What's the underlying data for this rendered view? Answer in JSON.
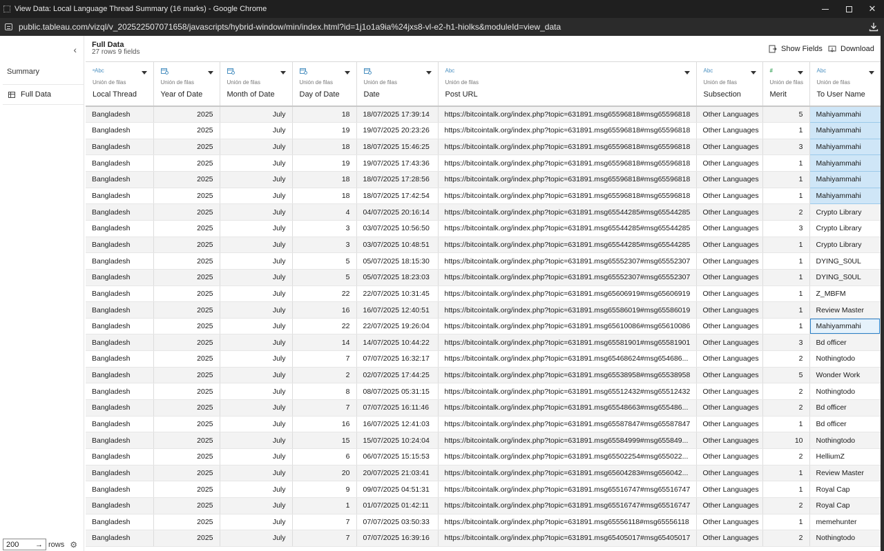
{
  "window": {
    "title": "View Data: Local Language Thread Summary (16 marks) - Google Chrome",
    "url": "public.tableau.com/vizql/v_202522507071658/javascripts/hybrid-window/min/index.html?id=1j1o1a9ia%24jxs8-vl-e2-h1-hiolks&moduleId=view_data"
  },
  "sidebar": {
    "collapse_glyph": "‹",
    "summary_label": "Summary",
    "fulldata_label": "Full Data",
    "rows_value": "200",
    "rows_arrow": "→",
    "rows_label": "rows"
  },
  "header": {
    "title": "Full Data",
    "subtitle": "27 rows 9 fields",
    "show_fields_label": "Show Fields",
    "download_label": "Download"
  },
  "columns": [
    {
      "type": "ᵃAbc",
      "source": "Unión de filas",
      "name": "Local Thread"
    },
    {
      "type": "date",
      "source": "Unión de filas",
      "name": "Year of Date"
    },
    {
      "type": "date",
      "source": "Unión de filas",
      "name": "Month of Date"
    },
    {
      "type": "date",
      "source": "Unión de filas",
      "name": "Day of Date"
    },
    {
      "type": "date",
      "source": "Unión de filas",
      "name": "Date"
    },
    {
      "type": "Abc",
      "source": "Unión de filas",
      "name": "Post URL"
    },
    {
      "type": "Abc",
      "source": "Unión de filas",
      "name": "Subsection"
    },
    {
      "type": "#",
      "source": "Unión de filas",
      "name": "Merit"
    },
    {
      "type": "Abc",
      "source": "Unión de filas",
      "name": "To User Name"
    }
  ],
  "rows": [
    [
      "Bangladesh",
      "2025",
      "July",
      "18",
      "18/07/2025 17:39:14",
      "https://bitcointalk.org/index.php?topic=631891.msg65596818#msg65596818",
      "Other Languages",
      "5",
      "Mahiyammahi"
    ],
    [
      "Bangladesh",
      "2025",
      "July",
      "19",
      "19/07/2025 20:23:26",
      "https://bitcointalk.org/index.php?topic=631891.msg65596818#msg65596818",
      "Other Languages",
      "1",
      "Mahiyammahi"
    ],
    [
      "Bangladesh",
      "2025",
      "July",
      "18",
      "18/07/2025 15:46:25",
      "https://bitcointalk.org/index.php?topic=631891.msg65596818#msg65596818",
      "Other Languages",
      "3",
      "Mahiyammahi"
    ],
    [
      "Bangladesh",
      "2025",
      "July",
      "19",
      "19/07/2025 17:43:36",
      "https://bitcointalk.org/index.php?topic=631891.msg65596818#msg65596818",
      "Other Languages",
      "1",
      "Mahiyammahi"
    ],
    [
      "Bangladesh",
      "2025",
      "July",
      "18",
      "18/07/2025 17:28:56",
      "https://bitcointalk.org/index.php?topic=631891.msg65596818#msg65596818",
      "Other Languages",
      "1",
      "Mahiyammahi"
    ],
    [
      "Bangladesh",
      "2025",
      "July",
      "18",
      "18/07/2025 17:42:54",
      "https://bitcointalk.org/index.php?topic=631891.msg65596818#msg65596818",
      "Other Languages",
      "1",
      "Mahiyammahi"
    ],
    [
      "Bangladesh",
      "2025",
      "July",
      "4",
      "04/07/2025 20:16:14",
      "https://bitcointalk.org/index.php?topic=631891.msg65544285#msg65544285",
      "Other Languages",
      "2",
      "Crypto Library"
    ],
    [
      "Bangladesh",
      "2025",
      "July",
      "3",
      "03/07/2025 10:56:50",
      "https://bitcointalk.org/index.php?topic=631891.msg65544285#msg65544285",
      "Other Languages",
      "3",
      "Crypto Library"
    ],
    [
      "Bangladesh",
      "2025",
      "July",
      "3",
      "03/07/2025 10:48:51",
      "https://bitcointalk.org/index.php?topic=631891.msg65544285#msg65544285",
      "Other Languages",
      "1",
      "Crypto Library"
    ],
    [
      "Bangladesh",
      "2025",
      "July",
      "5",
      "05/07/2025 18:15:30",
      "https://bitcointalk.org/index.php?topic=631891.msg65552307#msg65552307",
      "Other Languages",
      "1",
      "DYING_S0UL"
    ],
    [
      "Bangladesh",
      "2025",
      "July",
      "5",
      "05/07/2025 18:23:03",
      "https://bitcointalk.org/index.php?topic=631891.msg65552307#msg65552307",
      "Other Languages",
      "1",
      "DYING_S0UL"
    ],
    [
      "Bangladesh",
      "2025",
      "July",
      "22",
      "22/07/2025 10:31:45",
      "https://bitcointalk.org/index.php?topic=631891.msg65606919#msg65606919",
      "Other Languages",
      "1",
      "Z_MBFM"
    ],
    [
      "Bangladesh",
      "2025",
      "July",
      "16",
      "16/07/2025 12:40:51",
      "https://bitcointalk.org/index.php?topic=631891.msg65586019#msg65586019",
      "Other Languages",
      "1",
      "Review Master"
    ],
    [
      "Bangladesh",
      "2025",
      "July",
      "22",
      "22/07/2025 19:26:04",
      "https://bitcointalk.org/index.php?topic=631891.msg65610086#msg65610086",
      "Other Languages",
      "1",
      "Mahiyammahi"
    ],
    [
      "Bangladesh",
      "2025",
      "July",
      "14",
      "14/07/2025 10:44:22",
      "https://bitcointalk.org/index.php?topic=631891.msg65581901#msg65581901",
      "Other Languages",
      "3",
      "Bd officer"
    ],
    [
      "Bangladesh",
      "2025",
      "July",
      "7",
      "07/07/2025 16:32:17",
      "https://bitcointalk.org/index.php?topic=631891.msg65468624#msg654686...",
      "Other Languages",
      "2",
      "Nothingtodo"
    ],
    [
      "Bangladesh",
      "2025",
      "July",
      "2",
      "02/07/2025 17:44:25",
      "https://bitcointalk.org/index.php?topic=631891.msg65538958#msg65538958",
      "Other Languages",
      "5",
      "Wonder Work"
    ],
    [
      "Bangladesh",
      "2025",
      "July",
      "8",
      "08/07/2025 05:31:15",
      "https://bitcointalk.org/index.php?topic=631891.msg65512432#msg65512432",
      "Other Languages",
      "2",
      "Nothingtodo"
    ],
    [
      "Bangladesh",
      "2025",
      "July",
      "7",
      "07/07/2025 16:11:46",
      "https://bitcointalk.org/index.php?topic=631891.msg65548663#msg655486...",
      "Other Languages",
      "2",
      "Bd officer"
    ],
    [
      "Bangladesh",
      "2025",
      "July",
      "16",
      "16/07/2025 12:41:03",
      "https://bitcointalk.org/index.php?topic=631891.msg65587847#msg65587847",
      "Other Languages",
      "1",
      "Bd officer"
    ],
    [
      "Bangladesh",
      "2025",
      "July",
      "15",
      "15/07/2025 10:24:04",
      "https://bitcointalk.org/index.php?topic=631891.msg65584999#msg655849...",
      "Other Languages",
      "10",
      "Nothingtodo"
    ],
    [
      "Bangladesh",
      "2025",
      "July",
      "6",
      "06/07/2025 15:15:53",
      "https://bitcointalk.org/index.php?topic=631891.msg65502254#msg655022...",
      "Other Languages",
      "2",
      "HelliumZ"
    ],
    [
      "Bangladesh",
      "2025",
      "July",
      "20",
      "20/07/2025 21:03:41",
      "https://bitcointalk.org/index.php?topic=631891.msg65604283#msg656042...",
      "Other Languages",
      "1",
      "Review Master"
    ],
    [
      "Bangladesh",
      "2025",
      "July",
      "9",
      "09/07/2025 04:51:31",
      "https://bitcointalk.org/index.php?topic=631891.msg65516747#msg65516747",
      "Other Languages",
      "1",
      "Royal Cap"
    ],
    [
      "Bangladesh",
      "2025",
      "July",
      "1",
      "01/07/2025 01:42:11",
      "https://bitcointalk.org/index.php?topic=631891.msg65516747#msg65516747",
      "Other Languages",
      "2",
      "Royal Cap"
    ],
    [
      "Bangladesh",
      "2025",
      "July",
      "7",
      "07/07/2025 03:50:33",
      "https://bitcointalk.org/index.php?topic=631891.msg65556118#msg65556118",
      "Other Languages",
      "1",
      "memehunter"
    ],
    [
      "Bangladesh",
      "2025",
      "July",
      "7",
      "07/07/2025 16:39:16",
      "https://bitcointalk.org/index.php?topic=631891.msg65405017#msg65405017",
      "Other Languages",
      "2",
      "Nothingtodo"
    ]
  ],
  "highlight": {
    "selected_rows": [
      0,
      1,
      2,
      3,
      4,
      5
    ],
    "focused_row": 13,
    "selected_color": "#cfe6f7",
    "focus_color": "#2a80c8"
  }
}
